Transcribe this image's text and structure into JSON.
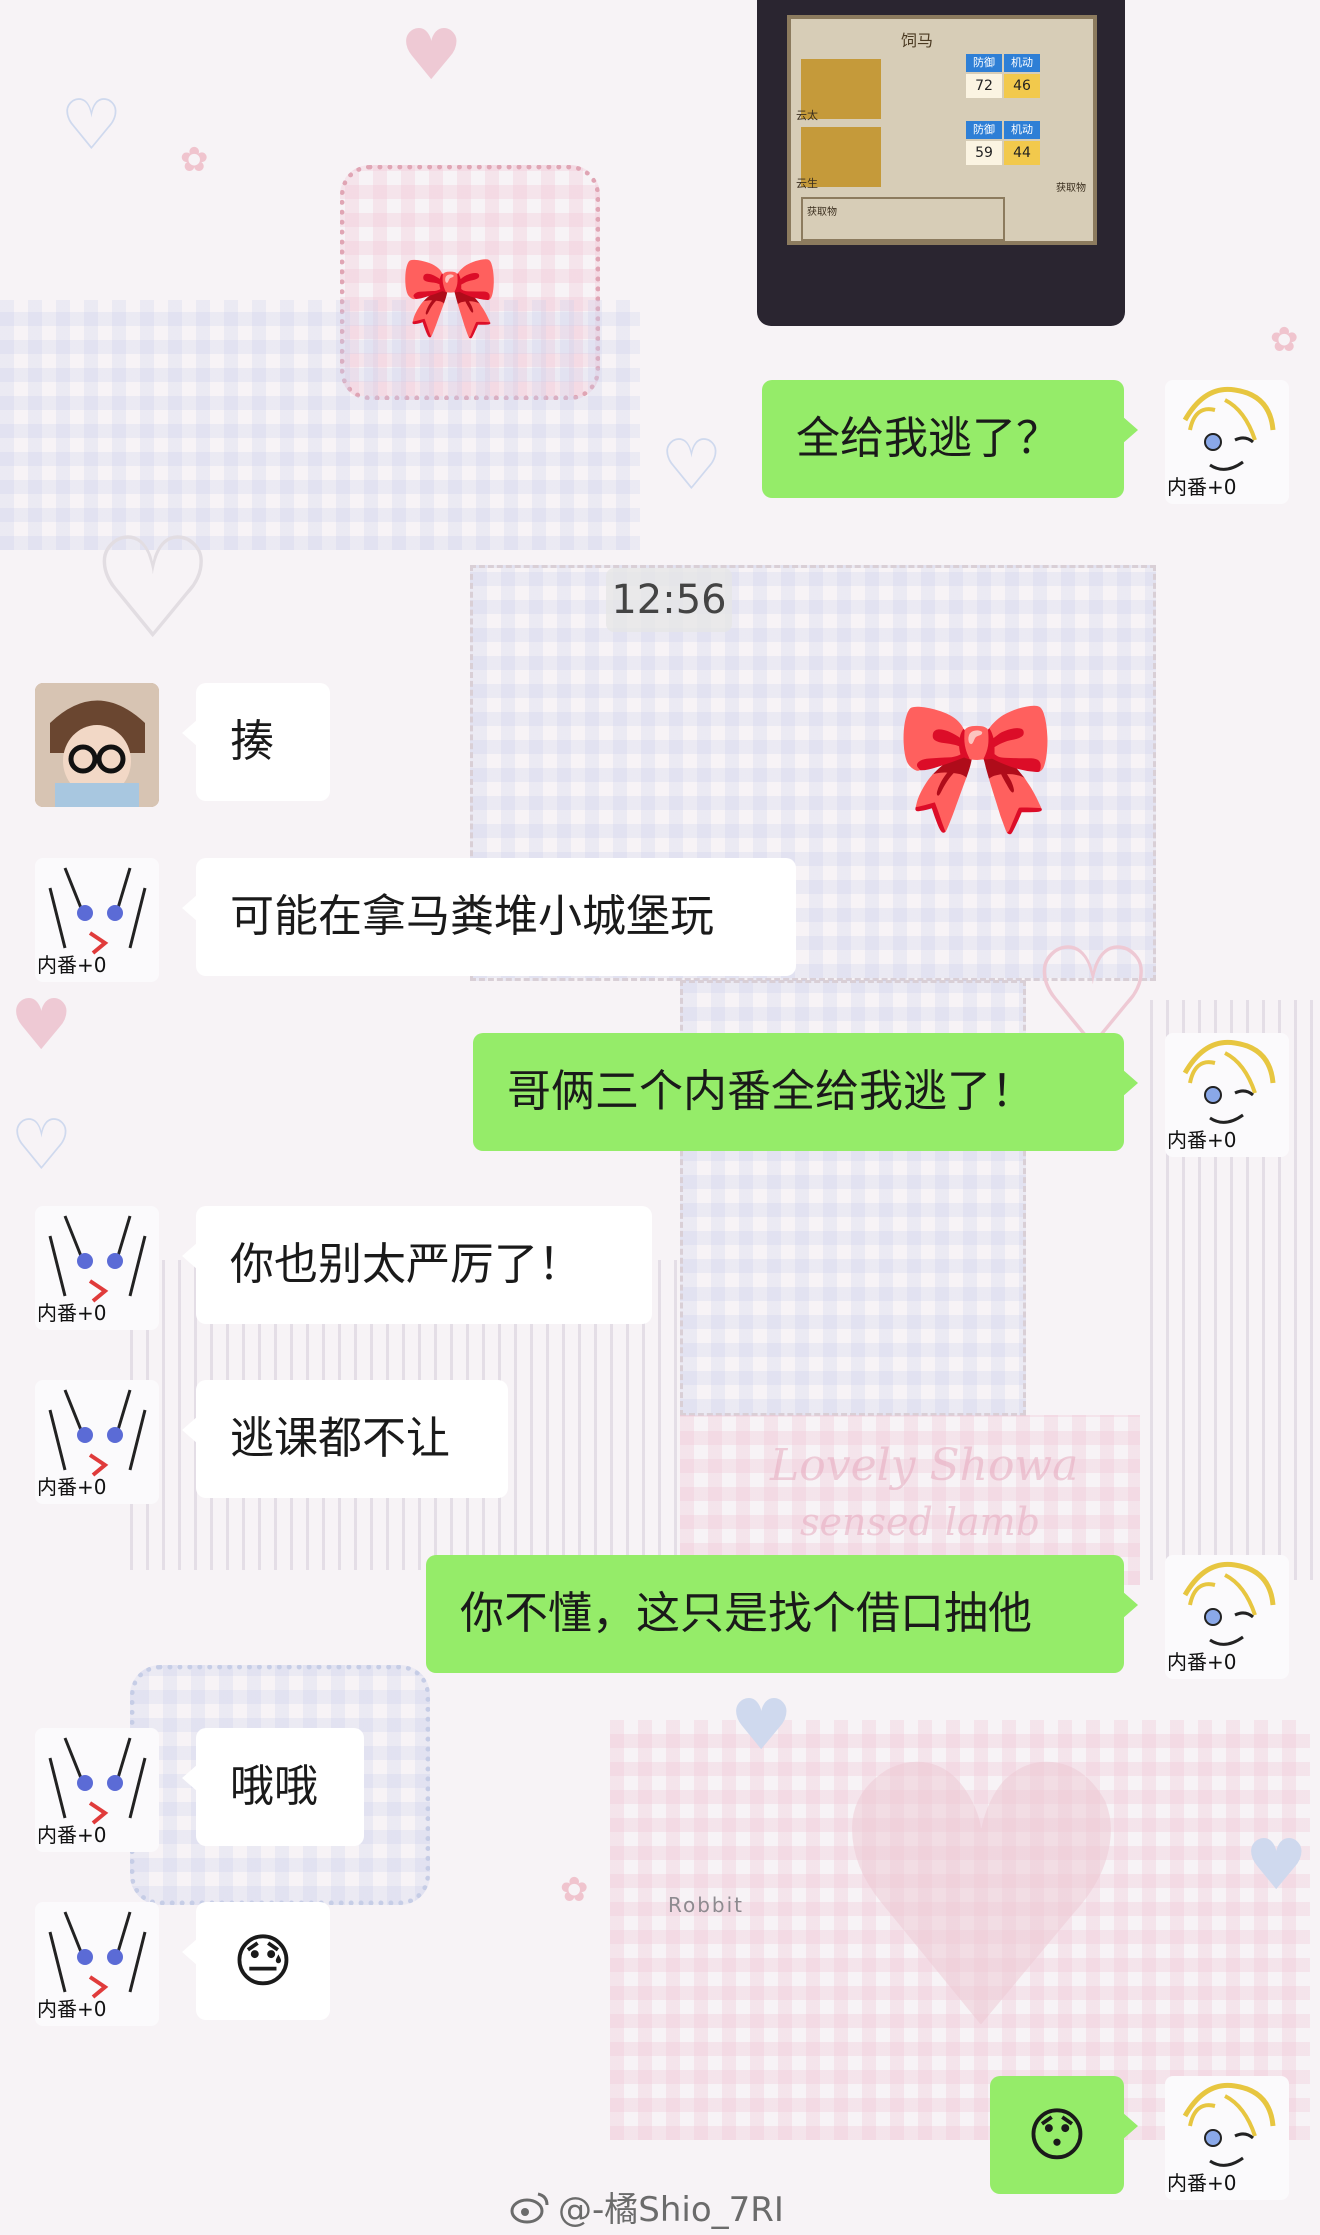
{
  "timestamp": "12:56",
  "game_screenshot": {
    "title": "饲马",
    "labels": [
      "防御",
      "机动",
      "防御",
      "机动"
    ],
    "row1": {
      "name": "云太",
      "v1": "72",
      "v2": "46"
    },
    "row2": {
      "name": "云生",
      "v1": "59",
      "v2": "44"
    },
    "side_label_1": "获取物",
    "side_label_2": "获取物"
  },
  "messages": [
    {
      "id": "m1",
      "side": "right",
      "text": "全给我逃了？"
    },
    {
      "id": "m2",
      "side": "left",
      "text": "揍"
    },
    {
      "id": "m3",
      "side": "left",
      "text": "可能在拿马粪堆小城堡玩"
    },
    {
      "id": "m4",
      "side": "right",
      "text": "哥俩三个内番全给我逃了！"
    },
    {
      "id": "m5",
      "side": "left",
      "text": "你也别太严厉了！"
    },
    {
      "id": "m6",
      "side": "left",
      "text": "逃课都不让"
    },
    {
      "id": "m7",
      "side": "right",
      "text": "你不懂，这只是找个借口抽他"
    },
    {
      "id": "m8",
      "side": "left",
      "text": "哦哦"
    },
    {
      "id": "m9",
      "side": "left",
      "text": "😓"
    },
    {
      "id": "m10",
      "side": "right",
      "text": "😯"
    }
  ],
  "avatar_caption": "内番+0",
  "background_text": {
    "lovely": "Lovely Showa",
    "lamb": "sensed lamb",
    "robbit": "Robbit"
  },
  "watermark": "@-橘Shio_7RI"
}
